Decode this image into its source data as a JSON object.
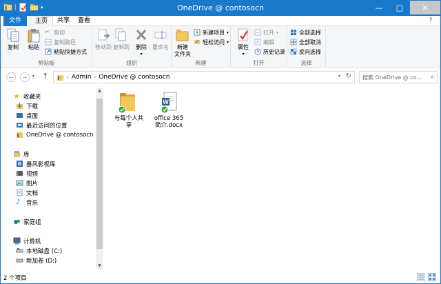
{
  "window": {
    "title": "OneDrive @ contosocn",
    "controls": {
      "minimize": "—",
      "maximize": "□",
      "close": "✕"
    }
  },
  "tabs": {
    "file": "文件",
    "home": "主页",
    "share": "共享",
    "view": "查看",
    "help": "?"
  },
  "ribbon": {
    "clipboard": {
      "label": "剪贴板",
      "copy": "复制",
      "paste": "粘贴",
      "cut": "剪切",
      "copy_path": "复制路径",
      "paste_shortcut": "粘贴快捷方式"
    },
    "organize": {
      "label": "组织",
      "move_to": "移动到",
      "copy_to": "复制到",
      "delete": "删除",
      "rename": "重命名"
    },
    "new": {
      "label": "新建",
      "new_folder": "新建\n文件夹",
      "new_folder_line1": "新建",
      "new_folder_line2": "文件夹",
      "new_item": "新建项目",
      "easy_access": "轻松访问"
    },
    "open": {
      "label": "打开",
      "properties": "属性",
      "open": "打开",
      "edit": "编辑",
      "history": "历史记录"
    },
    "select": {
      "label": "选择",
      "select_all": "全部选择",
      "select_none": "全部取消",
      "invert": "反向选择"
    }
  },
  "address": {
    "path": [
      "Admin",
      "OneDrive @ contosocn"
    ],
    "search_placeholder": "搜索 OneDrive @ co..."
  },
  "sidebar": {
    "favorites": {
      "label": "收藏夹",
      "items": [
        "下载",
        "桌面",
        "最近访问的位置",
        "OneDrive @ contosocn"
      ]
    },
    "libraries": {
      "label": "库",
      "items": [
        "暴风影视库",
        "视频",
        "图片",
        "文档",
        "音乐"
      ]
    },
    "homegroup": "家庭组",
    "computer": {
      "label": "计算机",
      "items": [
        "本地磁盘 (C:)",
        "新加卷 (D:)"
      ]
    }
  },
  "files": [
    {
      "name_line1": "与每个人共",
      "name_line2": "享",
      "type": "folder",
      "synced": true
    },
    {
      "name_line1": "office 365",
      "name_line2": "简介.docx",
      "type": "word-document",
      "synced": true
    }
  ],
  "status": {
    "item_count": "2 个项目"
  },
  "colors": {
    "accent": "#1979ca",
    "folder": "#e8c25f",
    "sync_ok": "#2ea52e",
    "word": "#2b579a"
  }
}
